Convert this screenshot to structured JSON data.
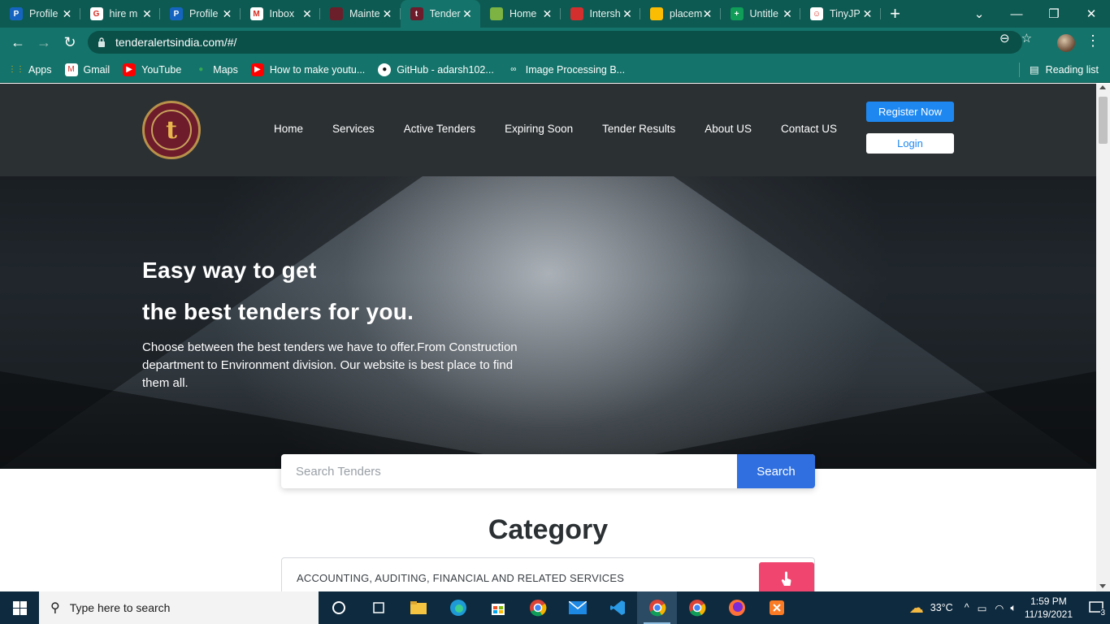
{
  "browser": {
    "tabs": [
      {
        "title": "Profile",
        "icon": "paypal-like-icon",
        "color": "#1565c0",
        "glyph": "P"
      },
      {
        "title": "hire m",
        "icon": "google-icon",
        "color": "#ffffff",
        "glyph": "G"
      },
      {
        "title": "Profile",
        "icon": "paypal-like-icon",
        "color": "#1565c0",
        "glyph": "P"
      },
      {
        "title": "Inbox",
        "icon": "gmail-icon",
        "color": "#ffffff",
        "glyph": "M"
      },
      {
        "title": "Mainte",
        "icon": "document-icon",
        "color": "#6b1f2a",
        "glyph": ""
      },
      {
        "title": "Tender",
        "icon": "tender-logo-icon",
        "color": "#6e1b2c",
        "glyph": "t"
      },
      {
        "title": "Home",
        "icon": "diamond-icon",
        "color": "#7cb342",
        "glyph": ""
      },
      {
        "title": "Intersh",
        "icon": "page-icon",
        "color": "#d32f2f",
        "glyph": ""
      },
      {
        "title": "placem",
        "icon": "google-drive-icon",
        "color": "#fbbc04",
        "glyph": ""
      },
      {
        "title": "Untitle",
        "icon": "google-sheets-icon",
        "color": "#0f9d58",
        "glyph": "+"
      },
      {
        "title": "TinyJP",
        "icon": "panda-icon",
        "color": "#ffffff",
        "glyph": "☺"
      }
    ],
    "active_tab_index": 5,
    "url": "tenderalertsindia.com/#/",
    "bookmarks": [
      {
        "label": "Apps",
        "icon": "apps-grid-icon"
      },
      {
        "label": "Gmail",
        "icon": "gmail-icon"
      },
      {
        "label": "YouTube",
        "icon": "youtube-icon"
      },
      {
        "label": "Maps",
        "icon": "maps-pin-icon"
      },
      {
        "label": "How to make youtu...",
        "icon": "youtube-icon"
      },
      {
        "label": "GitHub - adarsh102...",
        "icon": "github-icon"
      },
      {
        "label": "Image Processing B...",
        "icon": "infinity-icon"
      }
    ],
    "reading_list": "Reading list"
  },
  "site": {
    "nav": [
      "Home",
      "Services",
      "Active Tenders",
      "Expiring Soon",
      "Tender Results",
      "About US",
      "Contact US"
    ],
    "register_label": "Register Now",
    "login_label": "Login",
    "hero_line1": "Easy way to get",
    "hero_line2": "the best tenders for you.",
    "hero_text": "Choose between the best tenders we have to offer.From Construction department to Environment division. Our website is best place to find them all.",
    "search_placeholder": "Search Tenders",
    "search_button": "Search",
    "category_title": "Category",
    "category_first": "ACCOUNTING, AUDITING, FINANCIAL AND RELATED SERVICES",
    "accent": "#1e88f0",
    "category_button_color": "#f0456e"
  },
  "taskbar": {
    "search_placeholder": "Type here to search",
    "weather": "33°C",
    "time": "1:59 PM",
    "date": "11/19/2021",
    "notifications": "3"
  }
}
